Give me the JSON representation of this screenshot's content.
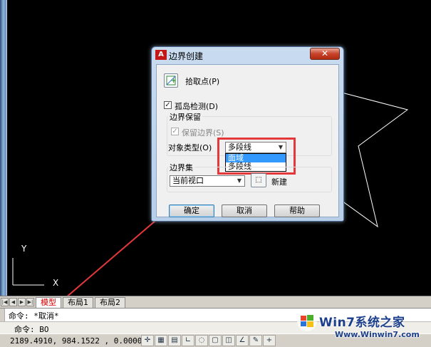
{
  "dialog": {
    "title": "边界创建",
    "close_icon": "close-icon",
    "pick_points_label": "拾取点(P)",
    "island_detection_label": "孤岛检测(D)",
    "island_detection_checked": true,
    "boundary_retention_title": "边界保留",
    "retain_boundaries_label": "保留边界(S)",
    "retain_boundaries_checked": true,
    "object_type_label": "对象类型(O)",
    "object_type_value": "多段线",
    "object_type_options": [
      "面域",
      "多段线"
    ],
    "object_type_highlighted": "面域",
    "boundary_set_title": "边界集",
    "boundary_set_value": "当前视口",
    "new_label": "新建",
    "ok_label": "确定",
    "cancel_label": "取消",
    "help_label": "帮助"
  },
  "canvas": {
    "ucs_y": "Y",
    "ucs_x": "X",
    "highlight_color": "#e5383b"
  },
  "layout_tabs": {
    "nav": [
      "|◀",
      "◀",
      "▶",
      "▶|"
    ],
    "tabs": [
      "模型",
      "布局1",
      "布局2"
    ],
    "active": "模型"
  },
  "command": {
    "line1": "命令: *取消*",
    "line2": "命令: BO"
  },
  "status": {
    "coordinates": "2189.4910, 984.1522 , 0.0000",
    "icons": [
      "snap-icon",
      "grid-icon",
      "ortho-icon",
      "polar-icon",
      "osnap-icon",
      "otrack-icon",
      "ducs-icon",
      "dyn-icon",
      "lineweight-icon",
      "qp-icon"
    ]
  },
  "watermark": {
    "title": "Win7系统之家",
    "url": "Www.Winwin7.com"
  }
}
